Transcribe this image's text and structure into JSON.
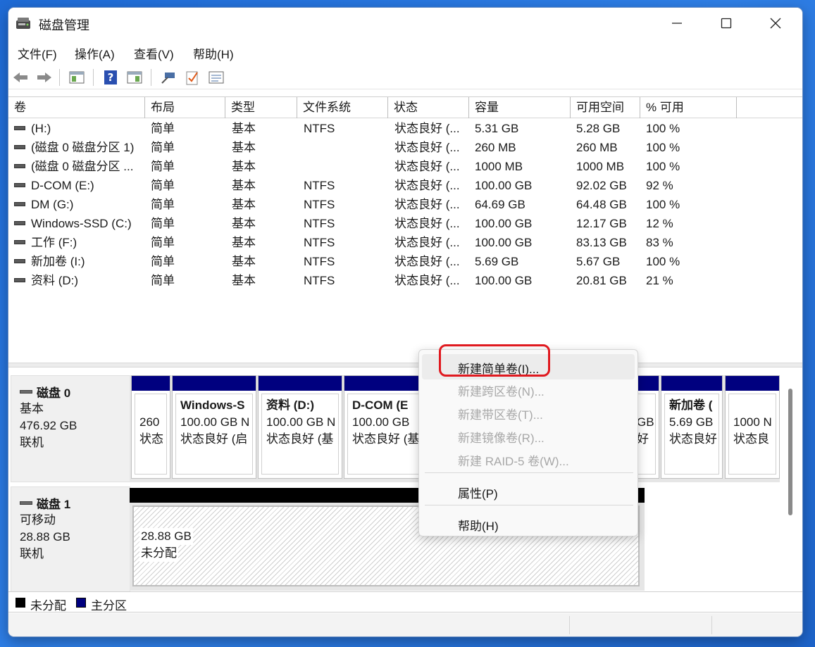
{
  "window": {
    "title": "磁盘管理",
    "icon": "disk-management-icon"
  },
  "menu": [
    "文件(F)",
    "操作(A)",
    "查看(V)",
    "帮助(H)"
  ],
  "toolbar": [
    "back-arrow-icon",
    "forward-arrow-icon",
    "console-tree-icon",
    "help-icon",
    "show-hide-icon",
    "connect-icon",
    "check-icon",
    "properties-icon"
  ],
  "volume_table": {
    "headers": [
      "卷",
      "布局",
      "类型",
      "文件系统",
      "状态",
      "容量",
      "可用空间",
      "% 可用"
    ],
    "rows": [
      [
        "(H:)",
        "简单",
        "基本",
        "NTFS",
        "状态良好 (...",
        "5.31 GB",
        "5.28 GB",
        "100 %"
      ],
      [
        "(磁盘 0 磁盘分区 1)",
        "简单",
        "基本",
        "",
        "状态良好 (...",
        "260 MB",
        "260 MB",
        "100 %"
      ],
      [
        "(磁盘 0 磁盘分区 ...",
        "简单",
        "基本",
        "",
        "状态良好 (...",
        "1000 MB",
        "1000 MB",
        "100 %"
      ],
      [
        "D-COM (E:)",
        "简单",
        "基本",
        "NTFS",
        "状态良好 (...",
        "100.00 GB",
        "92.02 GB",
        "92 %"
      ],
      [
        "DM (G:)",
        "简单",
        "基本",
        "NTFS",
        "状态良好 (...",
        "64.69 GB",
        "64.48 GB",
        "100 %"
      ],
      [
        "Windows-SSD (C:)",
        "简单",
        "基本",
        "NTFS",
        "状态良好 (...",
        "100.00 GB",
        "12.17 GB",
        "12 %"
      ],
      [
        "工作 (F:)",
        "简单",
        "基本",
        "NTFS",
        "状态良好 (...",
        "100.00 GB",
        "83.13 GB",
        "83 %"
      ],
      [
        "新加卷 (I:)",
        "简单",
        "基本",
        "NTFS",
        "状态良好 (...",
        "5.69 GB",
        "5.67 GB",
        "100 %"
      ],
      [
        "资料 (D:)",
        "简单",
        "基本",
        "NTFS",
        "状态良好 (...",
        "100.00 GB",
        "20.81 GB",
        "21 %"
      ]
    ]
  },
  "disks": [
    {
      "name": "磁盘 0",
      "type": "基本",
      "size": "476.92 GB",
      "status": "联机",
      "partitions": [
        {
          "name": "",
          "size": "260",
          "status": "状态"
        },
        {
          "name": "Windows-S",
          "size": "100.00 GB N",
          "status": "状态良好 (启"
        },
        {
          "name": "资料 (D:)",
          "size": "100.00 GB N",
          "status": "状态良好 (基"
        },
        {
          "name": "D-COM (E",
          "size": "100.00 GB",
          "status": "状态良好 (基"
        },
        {
          "name": "",
          "size": "GB",
          "status": "好"
        },
        {
          "name": "新加卷 (",
          "size": "5.69 GB",
          "status": "状态良好"
        },
        {
          "name": "",
          "size": "1000 N",
          "status": "状态良"
        }
      ]
    },
    {
      "name": "磁盘 1",
      "type": "可移动",
      "size": "28.88 GB",
      "status": "联机",
      "partitions": [
        {
          "name": "",
          "size": "28.88 GB",
          "status": "未分配"
        }
      ]
    }
  ],
  "legend": [
    {
      "label": "未分配",
      "color": "#000000"
    },
    {
      "label": "主分区",
      "color": "#00007f"
    }
  ],
  "context_menu": {
    "items": [
      {
        "label": "新建简单卷(I)...",
        "enabled": true,
        "highlighted": true
      },
      {
        "label": "新建跨区卷(N)...",
        "enabled": false
      },
      {
        "label": "新建带区卷(T)...",
        "enabled": false
      },
      {
        "label": "新建镜像卷(R)...",
        "enabled": false
      },
      {
        "label": "新建 RAID-5 卷(W)...",
        "enabled": false
      },
      {
        "label": "属性(P)",
        "enabled": true
      },
      {
        "label": "帮助(H)",
        "enabled": true
      }
    ]
  },
  "colors": {
    "primary_partition": "#00007f",
    "unallocated": "#000000",
    "annotation": "#e0191f",
    "desktop": "#2f7fe6"
  }
}
